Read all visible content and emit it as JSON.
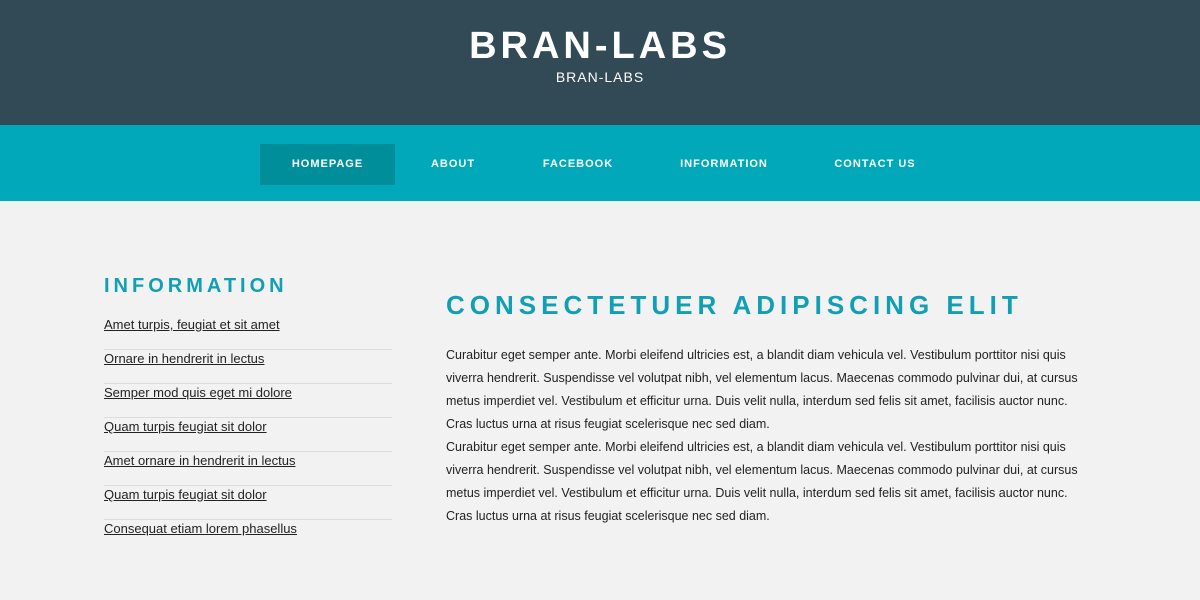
{
  "header": {
    "title": "BRAN-LABS",
    "subtitle": "BRAN-LABS"
  },
  "nav": {
    "items": [
      {
        "label": "HOMEPAGE",
        "active": true
      },
      {
        "label": "ABOUT",
        "active": false
      },
      {
        "label": "FACEBOOK",
        "active": false
      },
      {
        "label": "INFORMATION",
        "active": false
      },
      {
        "label": "CONTACT US",
        "active": false
      }
    ]
  },
  "sidebar": {
    "title": "INFORMATION",
    "links": [
      "Amet turpis, feugiat et sit amet",
      "Ornare in hendrerit in lectus",
      "Semper mod quis eget mi dolore",
      "Quam turpis feugiat sit dolor",
      "Amet ornare in hendrerit in lectus",
      "Quam turpis feugiat sit dolor",
      "Consequat etiam lorem phasellus"
    ]
  },
  "main": {
    "title": "CONSECTETUER ADIPISCING ELIT",
    "paragraphs": [
      "Curabitur eget semper ante. Morbi eleifend ultricies est, a blandit diam vehicula vel. Vestibulum porttitor nisi quis viverra hendrerit. Suspendisse vel volutpat nibh, vel elementum lacus. Maecenas commodo pulvinar dui, at cursus metus imperdiet vel. Vestibulum et efficitur urna. Duis velit nulla, interdum sed felis sit amet, facilisis auctor nunc. Cras luctus urna at risus feugiat scelerisque nec sed diam.",
      "Curabitur eget semper ante. Morbi eleifend ultricies est, a blandit diam vehicula vel. Vestibulum porttitor nisi quis viverra hendrerit. Suspendisse vel volutpat nibh, vel elementum lacus. Maecenas commodo pulvinar dui, at cursus metus imperdiet vel. Vestibulum et efficitur urna. Duis velit nulla, interdum sed felis sit amet, facilisis auctor nunc. Cras luctus urna at risus feugiat scelerisque nec sed diam."
    ]
  },
  "colors": {
    "header_bg": "#324a56",
    "nav_bg": "#01a8b9",
    "nav_active_bg": "#008e9b",
    "accent": "#109fb3",
    "page_bg": "#f2f2f2"
  }
}
